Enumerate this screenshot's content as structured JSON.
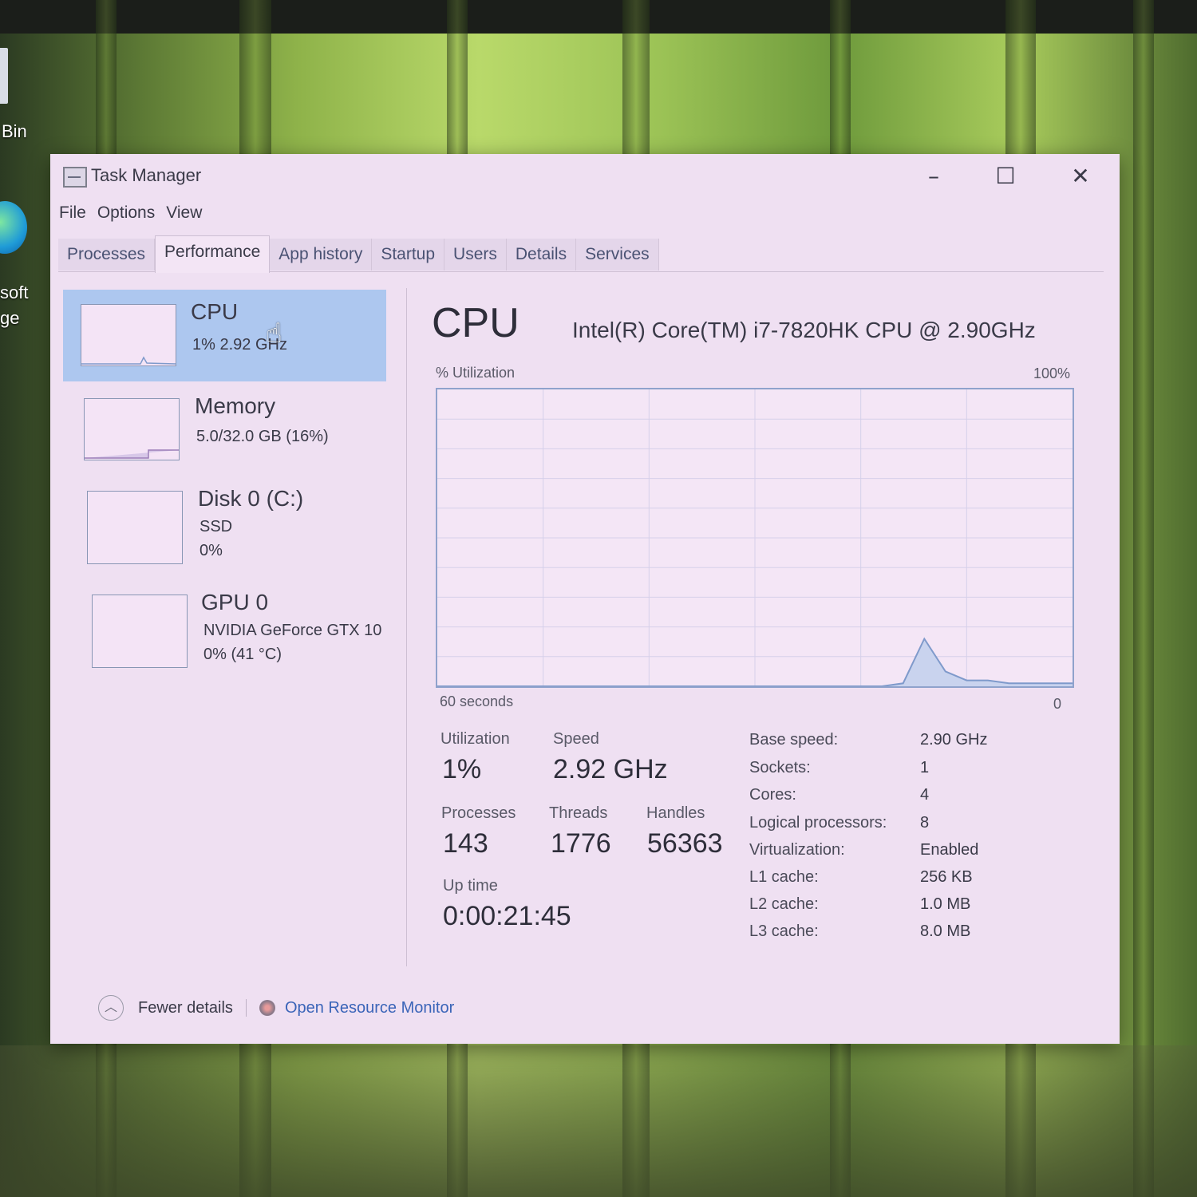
{
  "desktop": {
    "icon_labels": [
      "Bin",
      "soft",
      "ge"
    ]
  },
  "window": {
    "title": "Task Manager",
    "controls": {
      "minimize": "–",
      "maximize": "☐",
      "close": "✕"
    }
  },
  "menu": [
    "File",
    "Options",
    "View"
  ],
  "tabs": [
    "Processes",
    "Performance",
    "App history",
    "Startup",
    "Users",
    "Details",
    "Services"
  ],
  "sidebar": {
    "items": [
      {
        "name": "CPU",
        "line1": "1%  2.92 GHz",
        "line2": ""
      },
      {
        "name": "Memory",
        "line1": "5.0/32.0 GB (16%)",
        "line2": ""
      },
      {
        "name": "Disk 0 (C:)",
        "line1": "SSD",
        "line2": "0%"
      },
      {
        "name": "GPU 0",
        "line1": "NVIDIA GeForce GTX 10",
        "line2": "0%  (41 °C)"
      }
    ]
  },
  "main": {
    "title": "CPU",
    "model": "Intel(R) Core(TM) i7-7820HK CPU @ 2.90GHz",
    "graph": {
      "ylabel": "% Utilization",
      "ymax_label": "100%",
      "xlabel": "60 seconds",
      "xmin_label": "0"
    },
    "stats": {
      "utilization_label": "Utilization",
      "utilization": "1%",
      "speed_label": "Speed",
      "speed": "2.92 GHz",
      "processes_label": "Processes",
      "processes": "143",
      "threads_label": "Threads",
      "threads": "1776",
      "handles_label": "Handles",
      "handles": "56363",
      "uptime_label": "Up time",
      "uptime": "0:00:21:45"
    },
    "specs": [
      {
        "key": "Base speed:",
        "value": "2.90 GHz"
      },
      {
        "key": "Sockets:",
        "value": "1"
      },
      {
        "key": "Cores:",
        "value": "4"
      },
      {
        "key": "Logical processors:",
        "value": "8"
      },
      {
        "key": "Virtualization:",
        "value": "Enabled"
      },
      {
        "key": "L1 cache:",
        "value": "256 KB"
      },
      {
        "key": "L2 cache:",
        "value": "1.0 MB"
      },
      {
        "key": "L3 cache:",
        "value": "8.0 MB"
      }
    ]
  },
  "footer": {
    "fewer_details": "Fewer details",
    "resource_monitor": "Open Resource Monitor"
  },
  "chart_data": {
    "type": "area",
    "x": [
      60,
      56,
      52,
      48,
      44,
      40,
      36,
      34,
      32,
      30,
      28,
      26,
      24,
      22,
      20,
      18,
      16,
      14,
      12,
      10,
      8,
      6,
      4,
      2,
      0
    ],
    "values": [
      0,
      0,
      0,
      0,
      0,
      0,
      0,
      0,
      0,
      0,
      0,
      0,
      0,
      0,
      0,
      0,
      1,
      16,
      5,
      2,
      2,
      1,
      1,
      1,
      1
    ],
    "ylim": [
      0,
      100
    ],
    "xlim": [
      60,
      0
    ],
    "grid": true,
    "colors": {
      "line": "#7f9acb",
      "fill": "#c9d3ee"
    }
  }
}
